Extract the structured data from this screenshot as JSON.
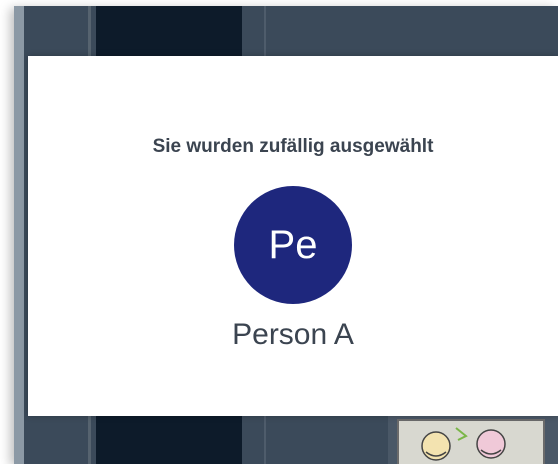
{
  "dialog": {
    "heading": "Sie wurden zufällig ausgewählt",
    "avatar_initials": "Pe",
    "person_name": "Person A"
  },
  "colors": {
    "avatar_bg": "#1e277d",
    "text": "#3b4450",
    "backdrop": "#3b4a5a",
    "dark_panel": "#0d1b2a"
  }
}
